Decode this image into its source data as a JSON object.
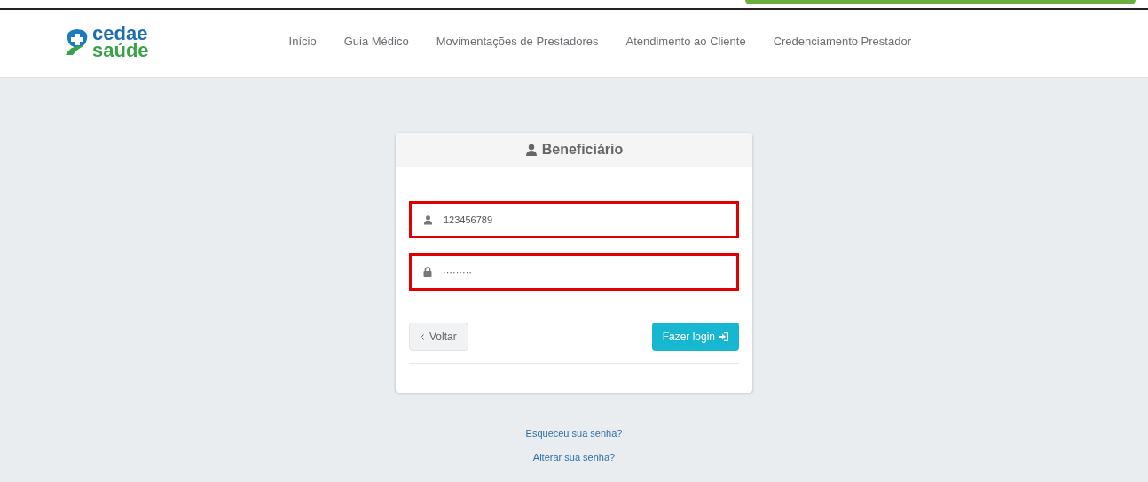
{
  "header": {
    "logo": {
      "line_1": "cedae",
      "line_2": "saúde"
    },
    "nav": [
      {
        "label": "Início"
      },
      {
        "label": "Guia Médico"
      },
      {
        "label": "Movimentações de Prestadores"
      },
      {
        "label": "Atendimento ao Cliente"
      },
      {
        "label": "Credenciamento Prestador"
      }
    ]
  },
  "login_card": {
    "title": "Beneficiário",
    "fields": [
      {
        "kind": "user",
        "value": "123456789",
        "highlighted": true
      },
      {
        "kind": "password",
        "value": "·········",
        "highlighted": true
      }
    ],
    "back_button": "Voltar",
    "login_button": "Fazer login"
  },
  "links": [
    "Esqueceu sua senha?",
    "Alterar sua senha?"
  ]
}
